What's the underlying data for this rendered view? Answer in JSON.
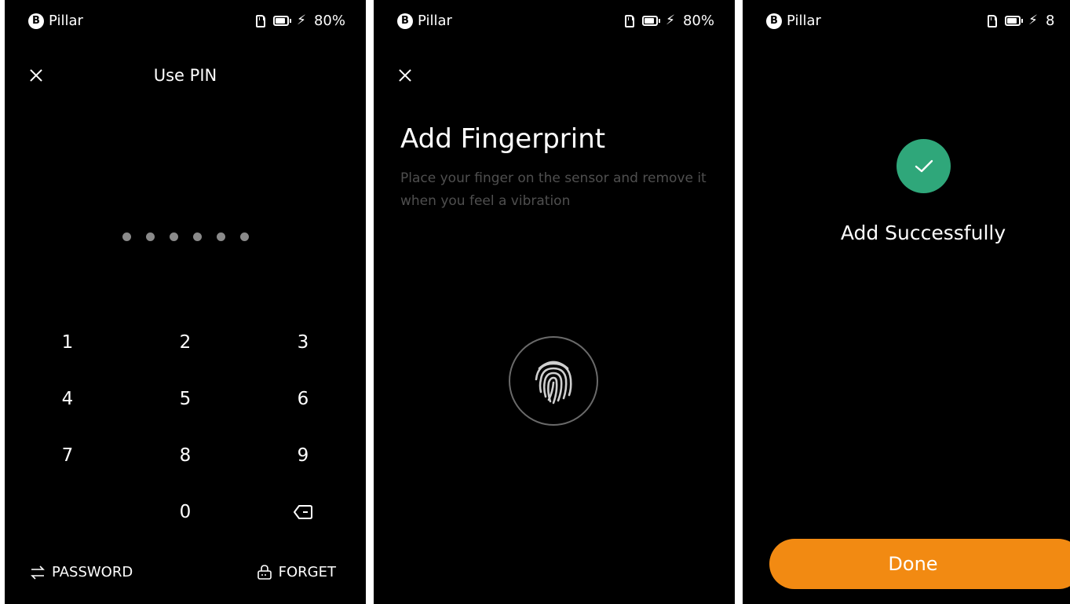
{
  "status_bar": {
    "brand_letter": "B",
    "brand_name": "Pillar",
    "battery_text": "80%",
    "battery_text_cropped": "8"
  },
  "screen_pin": {
    "title": "Use PIN",
    "pin_dot_count": 6,
    "keys": [
      [
        "1",
        "2",
        "3"
      ],
      [
        "4",
        "5",
        "6"
      ],
      [
        "7",
        "8",
        "9"
      ],
      [
        "",
        "0",
        "backspace"
      ]
    ],
    "password_label": "PASSWORD",
    "forget_label": "FORGET"
  },
  "screen_fingerprint": {
    "title": "Add Fingerprint",
    "subtitle": "Place your finger on the sensor and remove it when you feel a vibration"
  },
  "screen_success": {
    "message": "Add Successfully",
    "done_label": "Done"
  },
  "colors": {
    "background": "#000000",
    "accent_orange": "#f28a12",
    "success_green": "#2fa77a",
    "muted_text": "#4f4f4f",
    "pin_dot": "#8a8a8a"
  }
}
